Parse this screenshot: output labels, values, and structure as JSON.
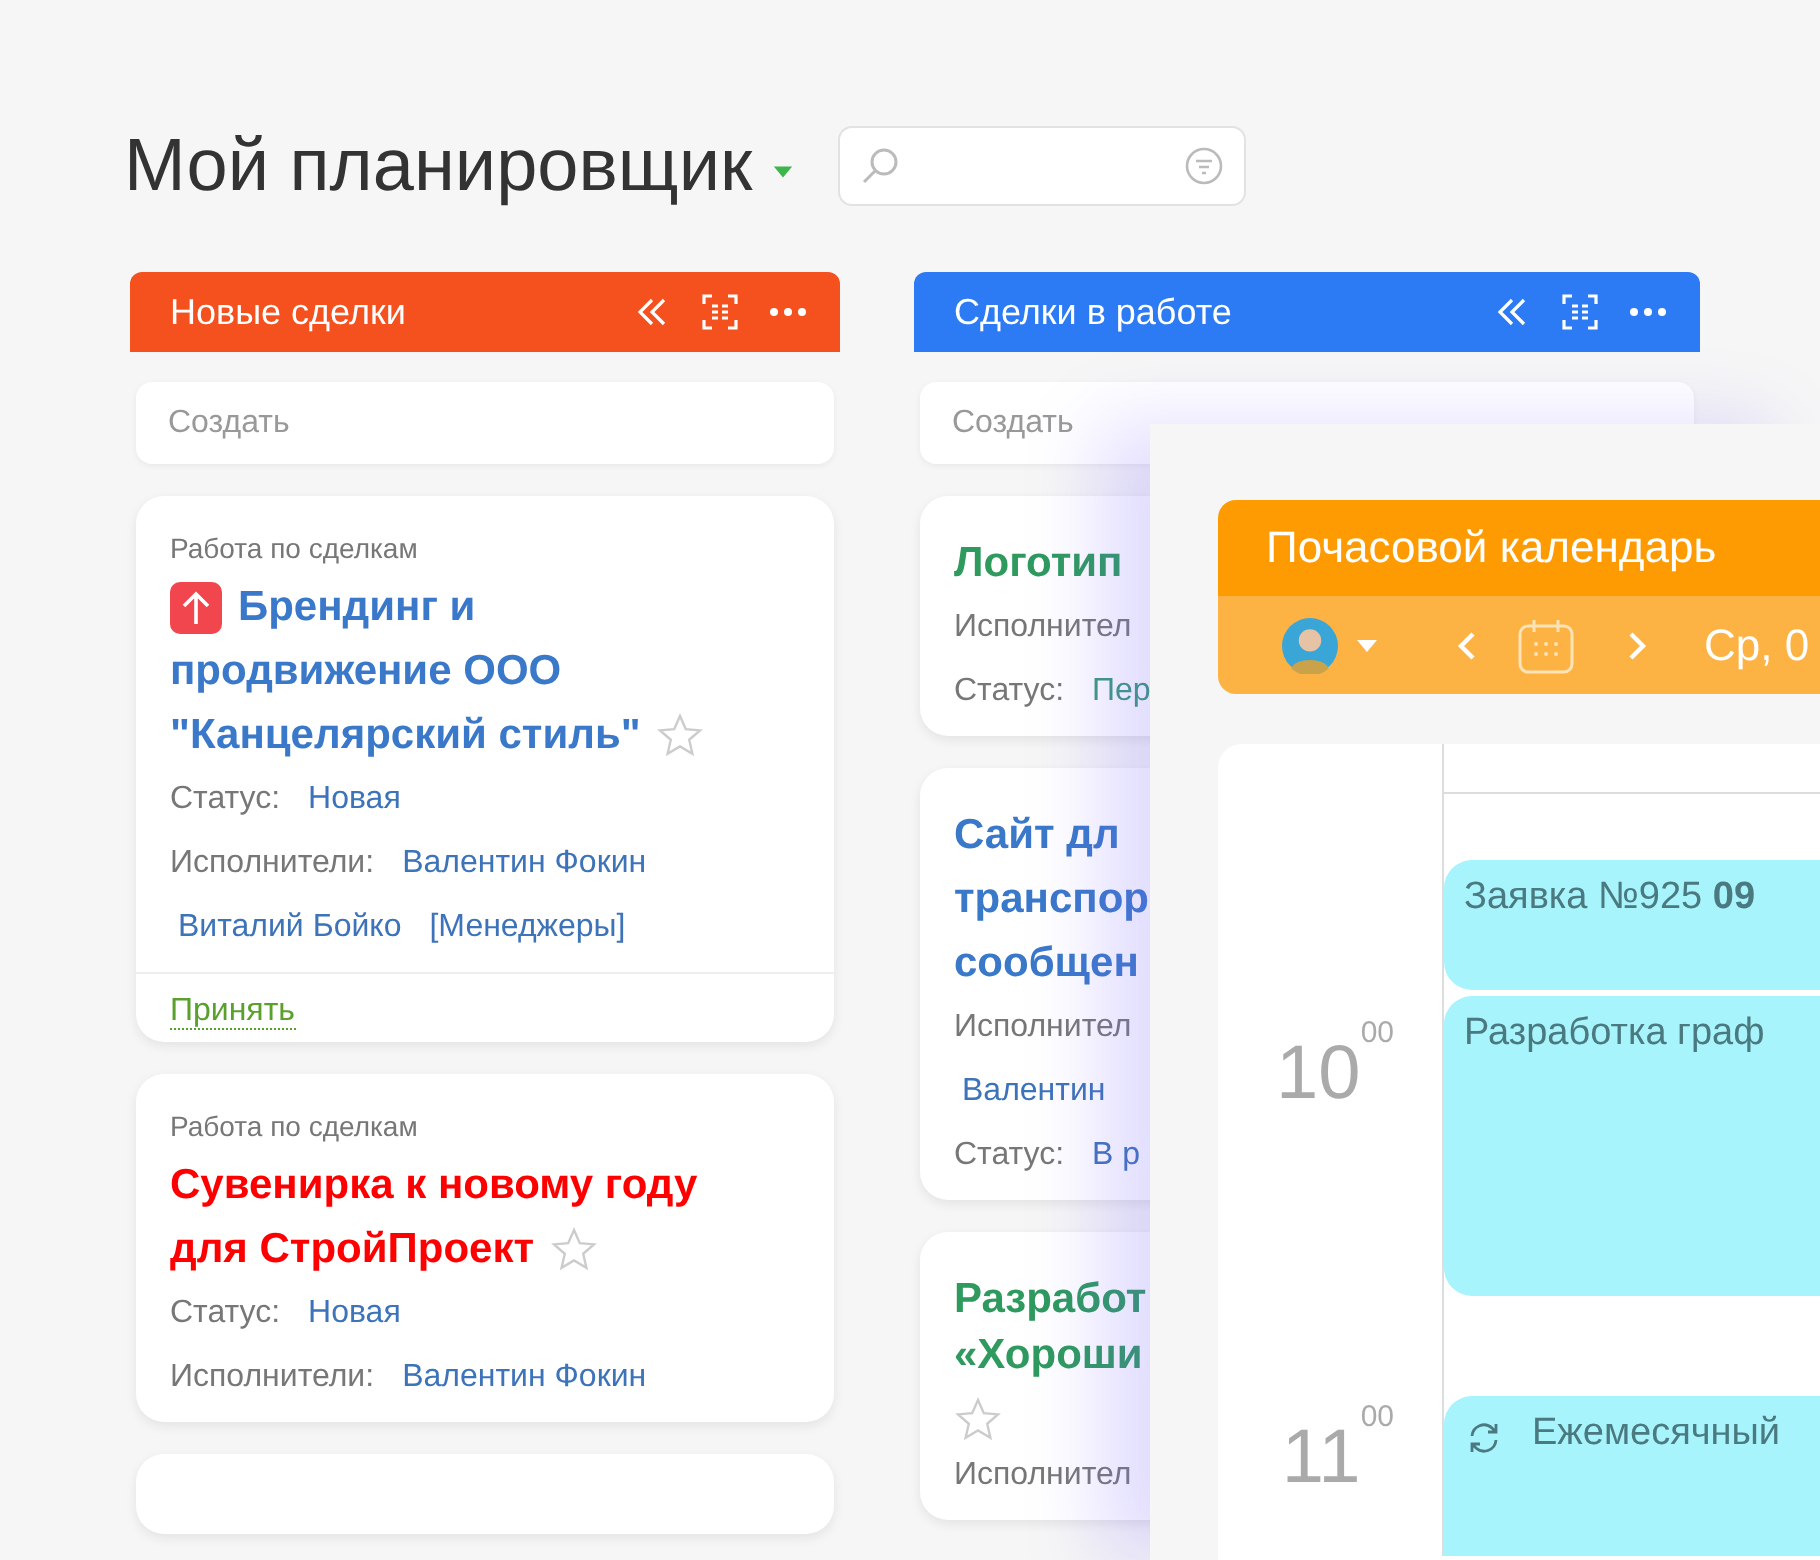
{
  "page_title": "Мой планировщик",
  "columns": [
    {
      "title": "Новые сделки",
      "color": "#f4511e",
      "create_placeholder": "Создать",
      "cards": [
        {
          "category": "Работа по сделкам",
          "priority": true,
          "title_lines": [
            "Брендинг и",
            "продвижение ООО",
            "\"Канцелярский стиль\""
          ],
          "color": "#3a78c9",
          "starred": false,
          "fields": [
            {
              "label": "Статус:",
              "values": [
                "Новая"
              ]
            },
            {
              "label": "Исполнители:",
              "values": [
                "Валентин Фокин",
                "Виталий Бойко",
                "[Менеджеры]"
              ]
            }
          ],
          "action": "Принять"
        },
        {
          "category": "Работа по сделкам",
          "priority": false,
          "title_lines": [
            "Сувенирка к новому году",
            "для СтройПроект"
          ],
          "color": "#ff0000",
          "starred": false,
          "fields": [
            {
              "label": "Статус:",
              "values": [
                "Новая"
              ]
            },
            {
              "label": "Исполнители:",
              "values": [
                "Валентин Фокин"
              ]
            }
          ]
        }
      ],
      "partial_card": true
    },
    {
      "title": "Сделки в работе",
      "color": "#2d7bf4",
      "create_placeholder": "Создать",
      "cards": [
        {
          "title_lines": [
            "Логотип"
          ],
          "color": "#2e9a5e",
          "fields": [
            {
              "label": "Исполнител"
            },
            {
              "label": "Статус:",
              "values": [
                "Пер"
              ],
              "color": "#3a9a7a"
            }
          ]
        },
        {
          "title_lines": [
            "Сайт дл",
            "транспор",
            "сообщен"
          ],
          "color": "#3a78c9",
          "fields": [
            {
              "label": "Исполнител"
            },
            {
              "values": [
                "Валентин"
              ]
            },
            {
              "label": "Статус:",
              "values": [
                "В р"
              ]
            }
          ]
        },
        {
          "title_lines": [
            "Разработ",
            "«Хороши"
          ],
          "color": "#2e9a5e",
          "starred": false,
          "fields": [
            {
              "label": "Исполнител"
            }
          ]
        }
      ]
    }
  ],
  "calendar": {
    "title": "Почасовой календарь",
    "date": "Ср, 0",
    "hours": [
      {
        "hour": "10",
        "minutes": "00"
      },
      {
        "hour": "11",
        "minutes": "00"
      }
    ],
    "events": [
      {
        "text": "Заявка №925 **09**",
        "repeat": false
      },
      {
        "text": "Разработка граф",
        "repeat": false
      },
      {
        "text": "Ежемесячный",
        "repeat": true
      }
    ]
  }
}
